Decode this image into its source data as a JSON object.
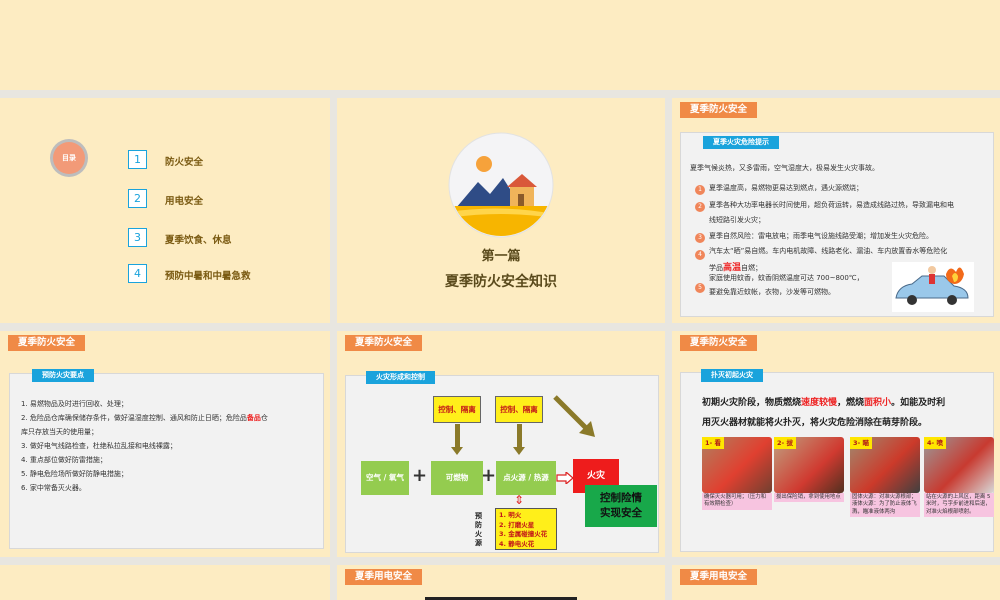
{
  "toc": {
    "badge": "目录",
    "items": [
      {
        "num": "1",
        "label": "防火安全"
      },
      {
        "num": "2",
        "label": "用电安全"
      },
      {
        "num": "3",
        "label": "夏季饮食、休息"
      },
      {
        "num": "4",
        "label": "预防中暑和中暑急救"
      }
    ]
  },
  "cover": {
    "chapter": "第一篇",
    "title": "夏季防火安全知识"
  },
  "risk": {
    "header": "夏季防火安全",
    "subtab": "夏季火灾危险提示",
    "intro": "夏季气候炎热，又多雷雨，空气湿度大，极易发生火灾事故。",
    "items": [
      {
        "n": "1",
        "lines": [
          "夏季温度高，易燃物更易达到燃点，遇火源燃烧；"
        ]
      },
      {
        "n": "2",
        "lines": [
          "夏季各种大功率电器长时间使用，超负荷运转，易造成线路过热，导致漏电和电",
          "线短路引发火灾；"
        ]
      },
      {
        "n": "3",
        "lines": [
          "夏季自然风险：雷电放电；雨季电气设施线路受潮；增加发生火灾危险。"
        ]
      },
      {
        "n": "4",
        "lines": [
          "汽车太“晒”易自燃。车内电机故障、线路老化、漏油、车内放置香水等危险化"
        ],
        "l2a": "学品",
        "l2hl": "高温",
        "l2b": "自燃；"
      },
      {
        "n": "5",
        "lines": [
          "家庭使用蚊香，蚊香阴燃温度可达 700~800℃，",
          "要避免靠近蚊帐，衣物，沙发等可燃物。"
        ]
      }
    ]
  },
  "prevent": {
    "header": "夏季防火安全",
    "subtab": "预防火灾要点",
    "items": [
      {
        "text": "1. 易燃物品及时进行回收、处理；"
      },
      {
        "text": "2. 危险品仓库确保储存条件，做好温湿度控制、通风和防止日晒；危险品",
        "hl": "备品",
        "rest": "仓"
      },
      {
        "text": "库只存放当天的使用量；"
      },
      {
        "text": "3. 做好电气线路检查，杜绝私拉乱接和电线裸露；"
      },
      {
        "text": "4. 重点部位做好防雷措施；"
      },
      {
        "text": "5. 静电危险场所做好防静电措施；"
      },
      {
        "text": "6. 家中常备灭火器。"
      }
    ]
  },
  "formation": {
    "header": "夏季防火安全",
    "subtab": "火灾形成和控制",
    "control1": "控制、隔离",
    "control2": "控制、隔离",
    "air": "空气 / 氧气",
    "plus": "+",
    "fuel": "可燃物",
    "ignition": "点火源 / 热源",
    "fire": "火灾",
    "result_line1": "控制险情",
    "result_line2": "实现安全",
    "prevent_label": "预防火源",
    "sources": [
      "1. 明火",
      "2. 打磨火星",
      "3. 金属碰撞火花",
      "4. 静电火花"
    ]
  },
  "extinguish": {
    "header": "夏季防火安全",
    "subtab": "扑灭初起火灾",
    "lead1a": "初期火灾阶段，物质燃烧",
    "lead1hl1": "速度较慢",
    "lead1b": "，燃烧",
    "lead1hl2": "面积小",
    "lead1c": "。如能及时利",
    "lead2": "用灭火器材就能将火扑灭，将火灾危险消除在萌芽阶段。",
    "steps": [
      {
        "label": "1- 看",
        "caption": "确保灭火器可用；（压力和有效期检查）"
      },
      {
        "label": "2- 拔",
        "caption": "拔出保险销，拿到使用地点"
      },
      {
        "label": "3- 瞄",
        "caption": "固体火源：对准火源根部；液体火源：为了防止液体飞溅，瞄准液体两沟"
      },
      {
        "label": "4- 喷",
        "caption": "站在火源的上风区，距离 5 米时，弓字步前进和后退，对准火焰根部喷射。"
      }
    ]
  },
  "electric": {
    "header1": "夏季用电安全",
    "header2": "夏季用电安全"
  },
  "colors": {
    "bg": "#fdecc2",
    "accent": "#f08a46",
    "blue": "#1aa3dc"
  }
}
